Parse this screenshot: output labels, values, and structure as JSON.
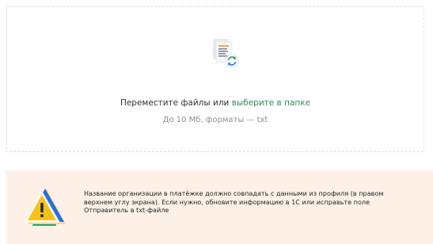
{
  "upload": {
    "prompt_text": "Переместите файлы или",
    "choose_link": "выберите в папке",
    "hint": "До 10 Мб, форматы — txt",
    "icon": "document-upload-icon"
  },
  "warning": {
    "icon": "warning-triangle-icon",
    "text": "Название организации в платёжке должно совпадать с данными из профиля (в правом верхнем углу экрана). Если нужно, обновите информацию в 1С или исправьте поле Отправитель в txt-файле"
  },
  "colors": {
    "link": "#2e8b57",
    "warning_background": "#fdf1e7",
    "hint_text": "#8a8f99"
  }
}
